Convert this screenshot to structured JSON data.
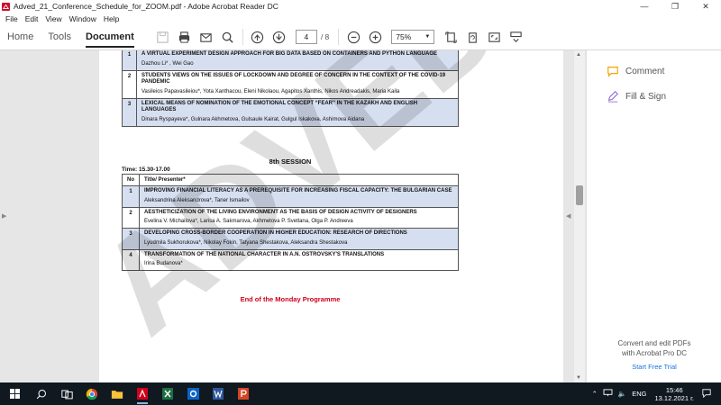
{
  "window": {
    "title": "Adved_21_Conference_Schedule_for_ZOOM.pdf - Adobe Acrobat Reader DC"
  },
  "menu": [
    "File",
    "Edit",
    "View",
    "Window",
    "Help"
  ],
  "toolbar": {
    "tabs": [
      "Home",
      "Tools",
      "Document"
    ],
    "page_current": "4",
    "page_total": "/ 8",
    "zoom": "75%"
  },
  "document": {
    "top_rows": [
      {
        "no": "1",
        "title": "A VIRTUAL EXPERIMENT DESIGN APPROACH FOR BIG DATA BASED ON CONTAINERS AND PYTHON LANGUAGE",
        "authors": "Dazhou Li* , Wei Gao",
        "shaded": true
      },
      {
        "no": "2",
        "title": "STUDENTS VIEWS ON THE ISSUES OF LOCKDOWN AND DEGREE OF CONCERN IN THE CONTEXT OF THE COVID-19 PANDEMIC",
        "authors": "Vasileios Papavasileiou*, Yota Xanthacou, Eleni Nikolaou, Agapitos Xanthis, Nikos Andreadakis, Maria Kaila",
        "shaded": false
      },
      {
        "no": "3",
        "title": "LEXICAL MEANS OF NOMINATION OF THE EMOTIONAL CONCEPT “FEAR” IN THE KAZAKH AND ENGLISH LANGUAGES",
        "authors": "Dinara Ryspayeva*, Gulnara Akhmetova, Gulsaule Kairat, Gulgul Iskakova, Ashimova Aidana",
        "shaded": true
      }
    ],
    "session_heading": "8th SESSION",
    "session_time": "Time: 15.30-17.00",
    "header_no": "No",
    "header_title": "Title/ Presenter*",
    "session_rows": [
      {
        "no": "1",
        "title": "IMPROVING FINANCIAL LITERACY AS A PREREQUISITE FOR INCREASING FISCAL CAPACITY: THE BULGARIAN CASE",
        "authors": "Aleksandrina Aleksandrova*, Taner Ismailov",
        "shaded": true
      },
      {
        "no": "2",
        "title": "AESTHETICIZATION OF THE LIVING ENVIRONMENT AS THE BASIS OF DESIGN ACTIVITY OF DESIGNERS",
        "authors": "Evelina V. Michailova*, Larisa A. Sakmarova, Akhmetova P. Svetlana, Olga P. Andreeva",
        "shaded": false
      },
      {
        "no": "3",
        "title": "DEVELOPING CROSS-BORDER COOPERATION IN HIGHER EDUCATION: RESEARCH OF DIRECTIONS",
        "authors": "Lyudmila Sukhorukova*, Nikolay Fokin, Tatyana Shestakova, Aleksandra Shestakova",
        "shaded": true
      },
      {
        "no": "4",
        "title": "TRANSFORMATION OF THE NATIONAL CHARACTER IN A.N. OSTROVSKY'S TRANSLATIONS",
        "authors": "Irina Budanova*",
        "shaded": false
      }
    ],
    "end_text": "End of the Monday Programme",
    "watermark_text": "ADVED"
  },
  "right_pane": {
    "comment_label": "Comment",
    "fill_sign_label": "Fill & Sign",
    "promo_line1": "Convert and edit PDFs",
    "promo_line2": "with Acrobat Pro DC",
    "trial_link": "Start Free Trial"
  },
  "taskbar": {
    "language": "ENG",
    "time": "15:46",
    "date": "13.12.2021 г."
  },
  "colors": {
    "row_shade": "#d6dff0",
    "end_text": "#d0021b",
    "link": "#1473e6",
    "taskbar": "#101820"
  }
}
